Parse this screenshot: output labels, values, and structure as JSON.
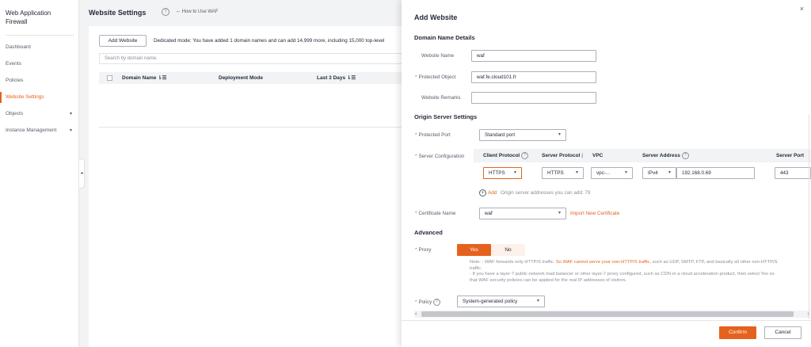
{
  "sidebar": {
    "title": "Web Application Firewall",
    "items": [
      {
        "label": "Dashboard"
      },
      {
        "label": "Events"
      },
      {
        "label": "Policies"
      },
      {
        "label": "Website Settings"
      },
      {
        "label": "Objects"
      },
      {
        "label": "Instance Management"
      }
    ],
    "collapse_glyph": "◂"
  },
  "main": {
    "title": "Website Settings",
    "help_glyph": "?",
    "how_to": "⇔ How to Use WAF",
    "add_button": "Add Website",
    "mode_text": "Dedicated mode: You have added 1 domain names and can add 14,999 more, including 15,000 top-level",
    "search_placeholder": "Search by domain name.",
    "columns": [
      "Domain Name ⇂☰",
      "Deployment Mode",
      "Last 3 Days ⇂☰"
    ]
  },
  "drawer": {
    "title": "Add Website",
    "close_glyph": "×",
    "sections": {
      "domain": "Domain Name Details",
      "origin": "Origin Server Settings",
      "advanced": "Advanced"
    },
    "website_name": {
      "label": "Website Name",
      "value": "waf"
    },
    "protected_object": {
      "label": "Protected Object",
      "value": "waf.fe.cloud101.fr"
    },
    "website_remarks": {
      "label": "Website Remarks",
      "value": ""
    },
    "protected_port": {
      "label": "Protected Port",
      "value": "Standard port"
    },
    "server_config": {
      "label": "Server Configuration",
      "headers": {
        "client_protocol": "Client Protocol",
        "server_protocol": "Server Protocol",
        "vpc": "VPC",
        "server_address": "Server Address",
        "server_port": "Server Port"
      },
      "client_protocol": "HTTPS",
      "server_protocol": "HTTPS",
      "vpc": "vpc-...",
      "ip_version": "IPv4",
      "address": "192.168.0.69",
      "port": "443"
    },
    "add_link": "Add",
    "add_hint": "Origin server addresses you can add: 79",
    "certificate": {
      "label": "Certificate Name",
      "value": "waf",
      "import_link": "Import New Certificate"
    },
    "proxy": {
      "label": "Proxy",
      "yes": "Yes",
      "no": "No",
      "note_prefix": "Note: - WAF forwards only HTTP/S traffic. ",
      "note_highlight": "So WAF cannot serve your non-HTTP/S traffic,",
      "note_rest": " such as UDP, SMTP, FTP, and basically all other non-HTTP/S traffic.",
      "note_line2": "- If you have a layer-7 public network load balancer or other layer-7 proxy configured, such as CDN or a cloud acceleration product, then select Yes so that WAF security policies can be applied for the real IP addresses of visitors."
    },
    "policy": {
      "label": "Policy",
      "value": "System-generated policy"
    },
    "confirm": "Confirm",
    "cancel": "Cancel",
    "required_mark": "*",
    "help_glyph": "?",
    "scroll_left": "‹",
    "scroll_right": "›",
    "add_circle_glyph": "+"
  },
  "colors": {
    "accent": "#e5621e",
    "text": "#252b3a",
    "muted": "#575d6c"
  }
}
